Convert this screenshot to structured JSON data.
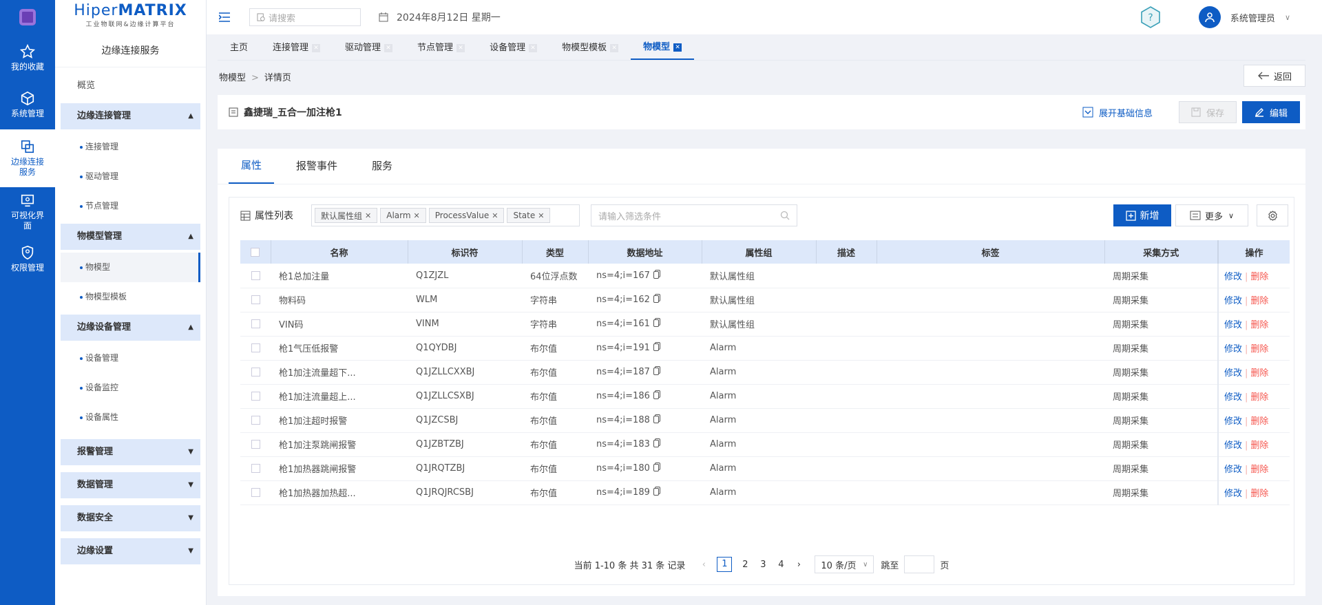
{
  "rail": {
    "items": [
      {
        "label": "我的收藏",
        "icon": "star-icon"
      },
      {
        "label": "系统管理",
        "icon": "cube-icon"
      },
      {
        "label": "边缘连接服务",
        "icon": "copy-icon"
      },
      {
        "label": "可视化界面",
        "icon": "screen-icon"
      },
      {
        "label": "权限管理",
        "icon": "shield-icon"
      }
    ]
  },
  "brand": {
    "name_a": "Hiper",
    "name_b": "MATRIX",
    "tagline": "工业物联网&边缘计算平台"
  },
  "sidebar": {
    "title": "边缘连接服务",
    "overview": "概览",
    "g1": "边缘连接管理",
    "g1_items": [
      "连接管理",
      "驱动管理",
      "节点管理"
    ],
    "g2": "物模型管理",
    "g2_items": [
      "物模型",
      "物模型模板"
    ],
    "g3": "边缘设备管理",
    "g3_items": [
      "设备管理",
      "设备监控",
      "设备属性"
    ],
    "g4": "报警管理",
    "g5": "数据管理",
    "g6": "数据安全",
    "g7": "边缘设置"
  },
  "topbar": {
    "search_placeholder": "请搜索",
    "date": "2024年8月12日 星期一",
    "user": "系统管理员"
  },
  "tabs": [
    "主页",
    "连接管理",
    "驱动管理",
    "节点管理",
    "设备管理",
    "物模型模板",
    "物模型"
  ],
  "breadcrumb": {
    "parent": "物模型",
    "sep": ">",
    "current": "详情页"
  },
  "back_label": "返回",
  "header": {
    "title": "鑫捷瑞_五合一加注枪1",
    "expand": "展开基础信息",
    "save": "保存",
    "edit": "编辑"
  },
  "panel_tabs": [
    "属性",
    "报警事件",
    "服务"
  ],
  "list": {
    "title": "属性列表",
    "chips": [
      "默认属性组",
      "Alarm",
      "ProcessValue",
      "State"
    ],
    "filter_placeholder": "请输入筛选条件",
    "new": "新增",
    "more": "更多"
  },
  "table": {
    "columns": [
      "名称",
      "标识符",
      "类型",
      "数据地址",
      "属性组",
      "描述",
      "标签",
      "采集方式",
      "操作"
    ],
    "edit": "修改",
    "delete": "删除",
    "rows": [
      [
        "枪1总加注量",
        "Q1ZJZL",
        "64位浮点数",
        "ns=4;i=167",
        "默认属性组",
        "",
        "",
        "周期采集"
      ],
      [
        "物料码",
        "WLM",
        "字符串",
        "ns=4;i=162",
        "默认属性组",
        "",
        "",
        "周期采集"
      ],
      [
        "VIN码",
        "VINM",
        "字符串",
        "ns=4;i=161",
        "默认属性组",
        "",
        "",
        "周期采集"
      ],
      [
        "枪1气压低报警",
        "Q1QYDBJ",
        "布尔值",
        "ns=4;i=191",
        "Alarm",
        "",
        "",
        "周期采集"
      ],
      [
        "枪1加注流量超下...",
        "Q1JZLLCXXBJ",
        "布尔值",
        "ns=4;i=187",
        "Alarm",
        "",
        "",
        "周期采集"
      ],
      [
        "枪1加注流量超上...",
        "Q1JZLLCSXBJ",
        "布尔值",
        "ns=4;i=186",
        "Alarm",
        "",
        "",
        "周期采集"
      ],
      [
        "枪1加注超时报警",
        "Q1JZCSBJ",
        "布尔值",
        "ns=4;i=188",
        "Alarm",
        "",
        "",
        "周期采集"
      ],
      [
        "枪1加注泵跳闸报警",
        "Q1JZBTZBJ",
        "布尔值",
        "ns=4;i=183",
        "Alarm",
        "",
        "",
        "周期采集"
      ],
      [
        "枪1加热器跳闸报警",
        "Q1JRQTZBJ",
        "布尔值",
        "ns=4;i=180",
        "Alarm",
        "",
        "",
        "周期采集"
      ],
      [
        "枪1加热器加热超...",
        "Q1JRQJRCSBJ",
        "布尔值",
        "ns=4;i=189",
        "Alarm",
        "",
        "",
        "周期采集"
      ]
    ]
  },
  "pager": {
    "summary": "当前 1-10 条 共 31 条 记录",
    "pages": [
      "1",
      "2",
      "3",
      "4"
    ],
    "current": "1",
    "size": "10 条/页",
    "jump": "跳至",
    "page_unit": "页"
  }
}
